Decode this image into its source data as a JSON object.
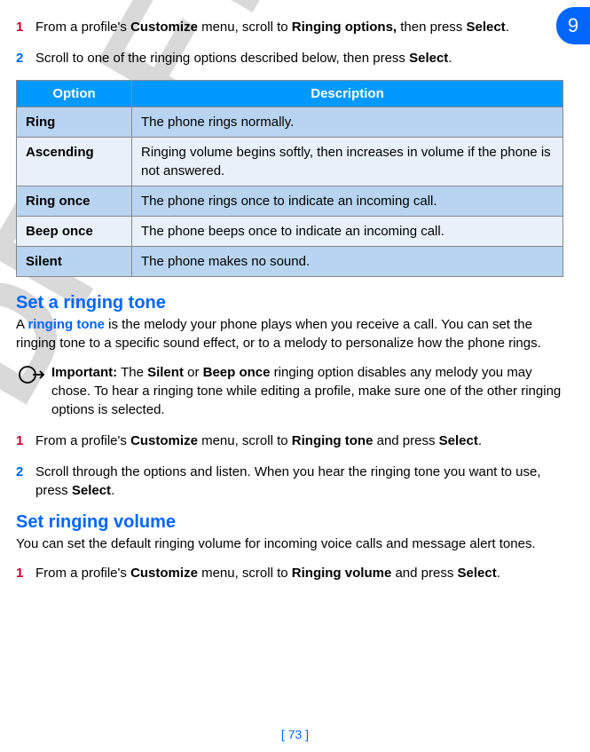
{
  "chapter_num": "9",
  "step1a_num": "1",
  "step1a_pre": "From a profile's ",
  "step1a_customize": "Customize",
  "step1a_mid1": " menu, scroll to ",
  "step1a_ringing_options": "Ringing options,",
  "step1a_mid2": " then press ",
  "step1a_select": "Select",
  "step1a_end": ".",
  "step2a_num": "2",
  "step2a_pre": "Scroll to one of the ringing options described below, then press ",
  "step2a_select": "Select",
  "step2a_end": ".",
  "table_header_option": "Option",
  "table_header_description": "Description",
  "row1_option": "Ring",
  "row1_desc": "The phone rings normally.",
  "row2_option": "Ascending",
  "row2_desc": "Ringing volume begins softly, then increases in volume if the phone is not answered.",
  "row3_option": "Ring once",
  "row3_desc": "The phone rings once to indicate an incoming call.",
  "row4_option": "Beep once",
  "row4_desc": "The phone beeps once to indicate an incoming call.",
  "row5_option": "Silent",
  "row5_desc": "The phone makes no sound.",
  "heading_ringing_tone": "Set a ringing tone",
  "ringing_tone_para_pre": "A ",
  "ringing_tone_term": "ringing tone",
  "ringing_tone_para_post": " is the melody your phone plays when you receive a call. You can set the ringing tone to a specific sound effect, or to a melody to personalize how the phone rings.",
  "important_label": "Important:",
  "important_pre": " The ",
  "important_silent": "Silent",
  "important_mid1": " or ",
  "important_beep": "Beep once",
  "important_post": " ringing option disables any melody you may chose. To hear a ringing tone while editing a profile, make sure one of the other ringing options is selected.",
  "step1b_num": "1",
  "step1b_pre": "From a profile's ",
  "step1b_customize": "Customize",
  "step1b_mid1": " menu, scroll to ",
  "step1b_ringing_tone": "Ringing tone",
  "step1b_mid2": " and press ",
  "step1b_select": "Select",
  "step1b_end": ".",
  "step2b_num": "2",
  "step2b_pre": "Scroll through the options and listen. When you hear the ringing tone you want to use, press ",
  "step2b_select": "Select",
  "step2b_end": ".",
  "heading_ringing_volume": "Set ringing volume",
  "ringing_volume_para": "You can set the default ringing volume for incoming voice calls and message alert tones.",
  "step1c_num": "1",
  "step1c_pre": "From a profile's ",
  "step1c_customize": "Customize",
  "step1c_mid1": " menu, scroll to ",
  "step1c_ringing_volume": "Ringing volume",
  "step1c_mid2": " and press ",
  "step1c_select": "Select",
  "step1c_end": ".",
  "page_number": "[ 73 ]",
  "watermark_text": "DRAFT"
}
